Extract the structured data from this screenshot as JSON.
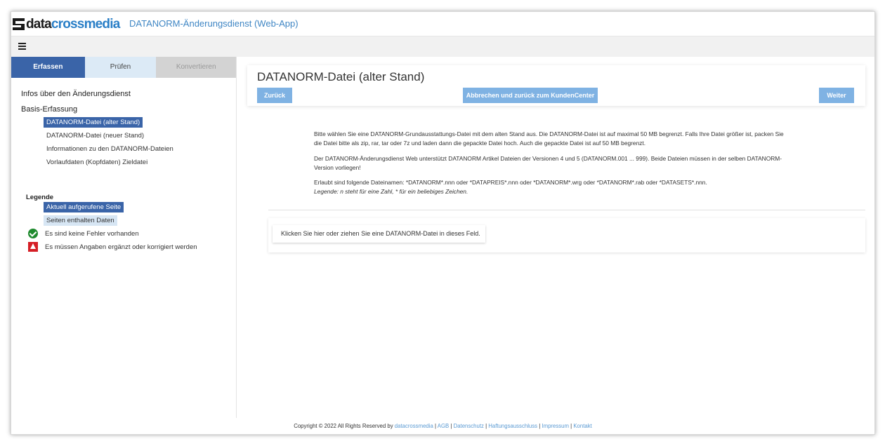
{
  "brand": {
    "logo_part1": "data",
    "logo_part2": "crossmedia",
    "accent": "#2a7fc7",
    "primary": "#3a64a8"
  },
  "header": {
    "app_title": "DATANORM-Änderungsdienst (Web-App)"
  },
  "menu": {
    "icon": "hamburger-icon"
  },
  "tabs": [
    {
      "label": "Erfassen",
      "state": "active"
    },
    {
      "label": "Prüfen",
      "state": "inactive"
    },
    {
      "label": "Konvertieren",
      "state": "disabled"
    }
  ],
  "sidebar": {
    "section1": "Infos über den Änderungsdienst",
    "section2": "Basis-Erfassung",
    "items": [
      {
        "label": "DATANORM-Datei (alter Stand)",
        "current": true
      },
      {
        "label": "DATANORM-Datei (neuer Stand)",
        "current": false
      },
      {
        "label": "Informationen zu den DATANORM-Dateien",
        "current": false
      },
      {
        "label": "Vorlaufdaten (Kopfdaten) Zieldatei",
        "current": false
      }
    ]
  },
  "legend": {
    "title": "Legende",
    "current_page": "Aktuell aufgerufene Seite",
    "has_data": "Seiten enthalten Daten",
    "no_errors": "Es sind keine Fehler vorhanden",
    "needs_fix": "Es müssen Angaben ergänzt oder korrigiert werden"
  },
  "main": {
    "title": "DATANORM-Datei (alter Stand)",
    "back_button": "Zurück",
    "cancel_button": "Abbrechen und zurück zum KundenCenter",
    "next_button": "Weiter",
    "para1_line1": "Bitte wählen Sie eine DATANORM-Grundausstattungs-Datei mit dem alten Stand aus. Die DATANORM-Datei ist auf maximal 50 MB begrenzt. Falls Ihre Datei größer ist, packen Sie",
    "para1_line2": "die Datei bitte als zip, rar, tar oder 7z und laden dann die gepackte Datei hoch. Auch die gepackte Datei ist auf 50 MB begrenzt.",
    "para2_line1": "Der DATANORM-Änderungsdienst Web unterstützt DATANORM Artikel Dateien der Versionen 4 und 5 (DATANORM.001 ... 999). Beide Dateien müssen in der selben DATANORM-",
    "para2_line2": "Version vorliegen!",
    "para3_line1": "Erlaubt sind folgende Dateinamen: *DATANORM*.nnn oder *DATAPREIS*.nnn oder *DATANORM*.wrg oder *DATANORM*.rab oder *DATASETS*.nnn.",
    "para3_line2": "Legende: n steht für eine Zahl, * für ein beliebiges Zeichen.",
    "dropzone": "Klicken Sie hier oder ziehen Sie eine DATANORM-Datei in dieses Feld."
  },
  "footer": {
    "copyright": "Copyright © 2022 All Rights Reserved by ",
    "company": "datacrossmedia",
    "links": [
      "AGB",
      "Datenschutz",
      "Haftungsausschluss",
      "Impressum",
      "Kontakt"
    ],
    "separator": " | "
  }
}
